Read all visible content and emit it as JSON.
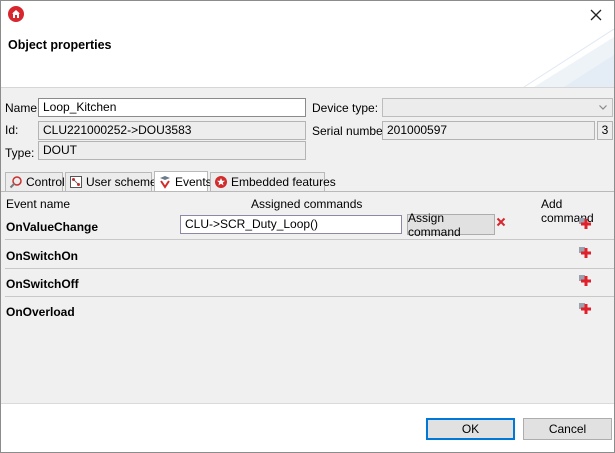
{
  "header": {
    "title": "Object properties"
  },
  "form": {
    "name_label": "Name:",
    "name_value": "Loop_Kitchen",
    "id_label": "Id:",
    "id_value": "CLU221000252->DOU3583",
    "type_label": "Type:",
    "type_value": "DOUT",
    "device_type_label": "Device type:",
    "device_type_value": "",
    "serial_label": "Serial number:",
    "serial_value": "201000597",
    "serial_suffix": "3"
  },
  "tabs": [
    {
      "label": "Control",
      "icon": "control-icon"
    },
    {
      "label": "User schemes",
      "icon": "user-schemes-icon"
    },
    {
      "label": "Events",
      "icon": "events-icon",
      "active": true
    },
    {
      "label": "Embedded features",
      "icon": "embedded-features-icon"
    }
  ],
  "events": {
    "col_event_name": "Event name",
    "col_assigned": "Assigned commands",
    "col_add": "Add command",
    "rows": [
      {
        "name": "OnValueChange",
        "command": "CLU->SCR_Duty_Loop()",
        "assign_label": "Assign command"
      },
      {
        "name": "OnSwitchOn"
      },
      {
        "name": "OnSwitchOff"
      },
      {
        "name": "OnOverload"
      }
    ]
  },
  "footer": {
    "ok_label": "OK",
    "cancel_label": "Cancel"
  },
  "colors": {
    "accent": "#0078d7",
    "brand": "#d8262f",
    "add_icon": "#e0202a"
  }
}
